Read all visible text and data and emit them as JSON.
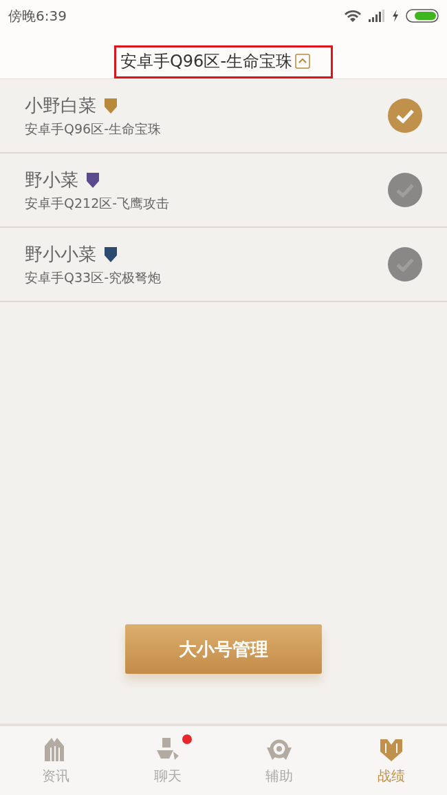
{
  "status_bar": {
    "time": "傍晚6:39"
  },
  "header": {
    "title": "安卓手Q96区-生命宝珠",
    "expanded": true,
    "highlighted": true
  },
  "accounts": [
    {
      "name": "小野白菜",
      "server": "安卓手Q96区-生命宝珠",
      "color": "#b8893a",
      "selected": true
    },
    {
      "name": "野小菜",
      "server": "安卓手Q212区-飞鹰攻击",
      "color": "#5a4a8e",
      "selected": false
    },
    {
      "name": "野小小菜",
      "server": "安卓手Q33区-究极弩炮",
      "color": "#2c4a6e",
      "selected": false
    }
  ],
  "manage_button": "大小号管理",
  "tabs": [
    {
      "label": "资讯",
      "kind": "news",
      "selected": false,
      "unread": false
    },
    {
      "label": "聊天",
      "kind": "chat",
      "selected": false,
      "unread": true
    },
    {
      "label": "辅助",
      "kind": "assist",
      "selected": false,
      "unread": false
    },
    {
      "label": "战绩",
      "kind": "record",
      "selected": true,
      "unread": false
    }
  ]
}
